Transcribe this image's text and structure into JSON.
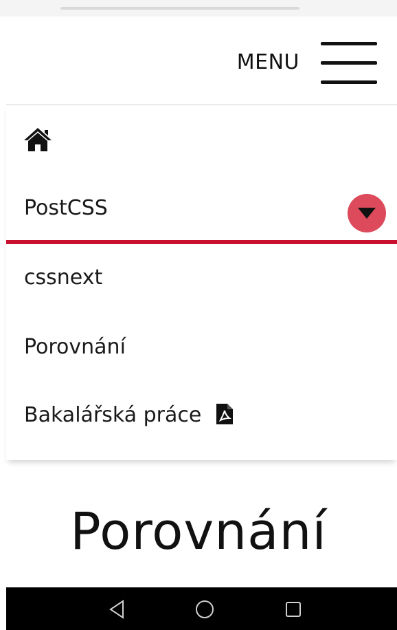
{
  "header": {
    "menu_label": "MENU",
    "icon": "hamburger-menu-icon"
  },
  "nav": {
    "home_icon": "home-icon",
    "items": [
      {
        "label": "PostCSS",
        "active": true,
        "has_submenu": true
      },
      {
        "label": "cssnext"
      },
      {
        "label": "Porovnání"
      },
      {
        "label": "Bakalářská práce",
        "icon": "pdf-file-icon"
      }
    ]
  },
  "main": {
    "title": "Porovnání"
  },
  "system_bar": {
    "buttons": [
      "back-icon",
      "home-circle-icon",
      "recent-apps-icon"
    ]
  },
  "colors": {
    "accent": "#c8102e",
    "toggle": "#dc4a5b",
    "text": "#1a1a1a",
    "system_bar": "#000000"
  }
}
